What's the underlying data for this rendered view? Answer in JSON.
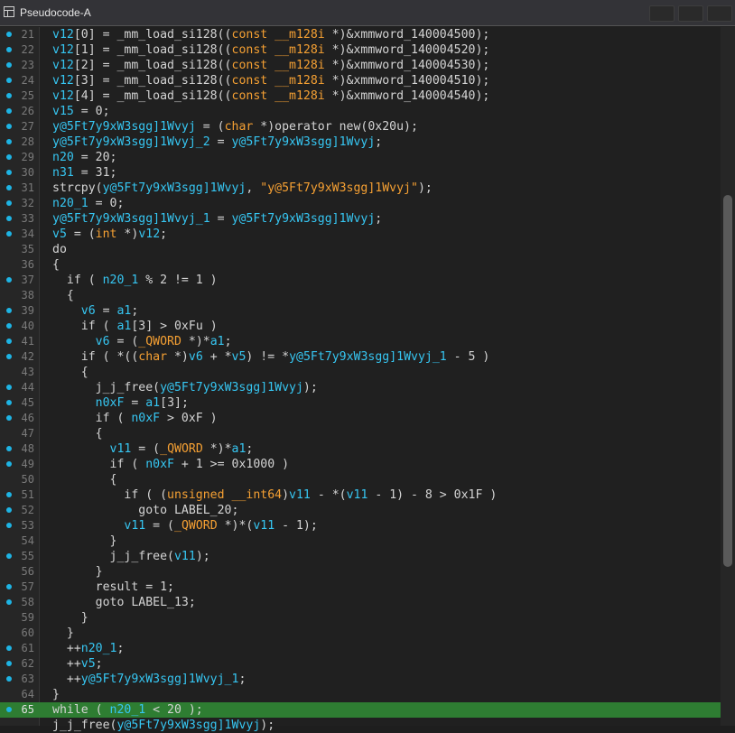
{
  "window": {
    "title": "Pseudocode-A",
    "icon": "pseudocode-window-icon"
  },
  "colors": {
    "highlight": "#2e7d32",
    "breakpoint_dot": "#1eb4e4",
    "variable": "#36c6f2",
    "type_keyword": "#f5a033"
  },
  "highlighted_line": 65,
  "lines": [
    {
      "n": "21",
      "dot": true,
      "t": "v12[0] = _mm_load_si128((const __m128i *)&xmmword_140004500);"
    },
    {
      "n": "22",
      "dot": true,
      "t": "v12[1] = _mm_load_si128((const __m128i *)&xmmword_140004520);"
    },
    {
      "n": "23",
      "dot": true,
      "t": "v12[2] = _mm_load_si128((const __m128i *)&xmmword_140004530);"
    },
    {
      "n": "24",
      "dot": true,
      "t": "v12[3] = _mm_load_si128((const __m128i *)&xmmword_140004510);"
    },
    {
      "n": "25",
      "dot": true,
      "t": "v12[4] = _mm_load_si128((const __m128i *)&xmmword_140004540);"
    },
    {
      "n": "26",
      "dot": true,
      "t": "v15 = 0;"
    },
    {
      "n": "27",
      "dot": true,
      "t": "y@5Ft7y9xW3sgg]1Wvyj = (char *)operator new(0x20u);"
    },
    {
      "n": "28",
      "dot": true,
      "t": "y@5Ft7y9xW3sgg]1Wvyj_2 = y@5Ft7y9xW3sgg]1Wvyj;"
    },
    {
      "n": "29",
      "dot": true,
      "t": "n20 = 20;"
    },
    {
      "n": "30",
      "dot": true,
      "t": "n31 = 31;"
    },
    {
      "n": "31",
      "dot": true,
      "t": "strcpy(y@5Ft7y9xW3sgg]1Wvyj, \"y@5Ft7y9xW3sgg]1Wvyj\");"
    },
    {
      "n": "32",
      "dot": true,
      "t": "n20_1 = 0;"
    },
    {
      "n": "33",
      "dot": true,
      "t": "y@5Ft7y9xW3sgg]1Wvyj_1 = y@5Ft7y9xW3sgg]1Wvyj;"
    },
    {
      "n": "34",
      "dot": true,
      "t": "v5 = (int *)v12;"
    },
    {
      "n": "35",
      "dot": false,
      "t": "do"
    },
    {
      "n": "36",
      "dot": false,
      "t": "{"
    },
    {
      "n": "37",
      "dot": true,
      "t": "  if ( n20_1 % 2 != 1 )"
    },
    {
      "n": "38",
      "dot": false,
      "t": "  {"
    },
    {
      "n": "39",
      "dot": true,
      "t": "    v6 = a1;"
    },
    {
      "n": "40",
      "dot": true,
      "t": "    if ( a1[3] > 0xFu )"
    },
    {
      "n": "41",
      "dot": true,
      "t": "      v6 = (_QWORD *)*a1;"
    },
    {
      "n": "42",
      "dot": true,
      "t": "    if ( *((char *)v6 + *v5) != *y@5Ft7y9xW3sgg]1Wvyj_1 - 5 )"
    },
    {
      "n": "43",
      "dot": false,
      "t": "    {"
    },
    {
      "n": "44",
      "dot": true,
      "t": "      j_j_free(y@5Ft7y9xW3sgg]1Wvyj);"
    },
    {
      "n": "45",
      "dot": true,
      "t": "      n0xF = a1[3];"
    },
    {
      "n": "46",
      "dot": true,
      "t": "      if ( n0xF > 0xF )"
    },
    {
      "n": "47",
      "dot": false,
      "t": "      {"
    },
    {
      "n": "48",
      "dot": true,
      "t": "        v11 = (_QWORD *)*a1;"
    },
    {
      "n": "49",
      "dot": true,
      "t": "        if ( n0xF + 1 >= 0x1000 )"
    },
    {
      "n": "50",
      "dot": false,
      "t": "        {"
    },
    {
      "n": "51",
      "dot": true,
      "t": "          if ( (unsigned __int64)v11 - *(v11 - 1) - 8 > 0x1F )"
    },
    {
      "n": "52",
      "dot": true,
      "t": "            goto LABEL_20;"
    },
    {
      "n": "53",
      "dot": true,
      "t": "          v11 = (_QWORD *)*(v11 - 1);"
    },
    {
      "n": "54",
      "dot": false,
      "t": "        }"
    },
    {
      "n": "55",
      "dot": true,
      "t": "        j_j_free(v11);"
    },
    {
      "n": "56",
      "dot": false,
      "t": "      }"
    },
    {
      "n": "57",
      "dot": true,
      "t": "      result = 1;"
    },
    {
      "n": "58",
      "dot": true,
      "t": "      goto LABEL_13;"
    },
    {
      "n": "59",
      "dot": false,
      "t": "    }"
    },
    {
      "n": "60",
      "dot": false,
      "t": "  }"
    },
    {
      "n": "61",
      "dot": true,
      "t": "  ++n20_1;"
    },
    {
      "n": "62",
      "dot": true,
      "t": "  ++v5;"
    },
    {
      "n": "63",
      "dot": true,
      "t": "  ++y@5Ft7y9xW3sgg]1Wvyj_1;"
    },
    {
      "n": "64",
      "dot": false,
      "t": "}"
    },
    {
      "n": "65",
      "dot": true,
      "t": "while ( n20_1 < 20 );"
    },
    {
      "n": "",
      "dot": false,
      "t": "j_j_free(y@5Ft7y9xW3sgg]1Wvyj);"
    }
  ]
}
